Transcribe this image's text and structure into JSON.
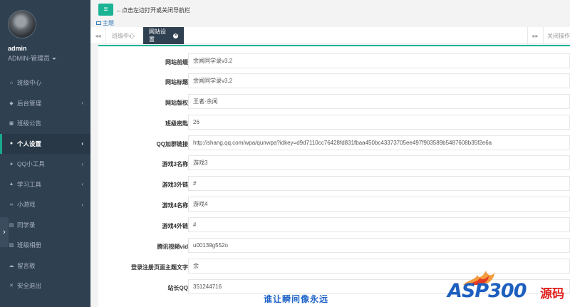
{
  "user": {
    "name": "admin",
    "role": "ADMIN-管理员"
  },
  "topbar": {
    "hint": "←点击左边打开或关闭导航栏",
    "theme": "主题"
  },
  "nav": [
    {
      "label": "班级中心",
      "icon": "home-icon",
      "glyph": "⌂",
      "chevron": false,
      "active": false
    },
    {
      "label": "后台管理",
      "icon": "dashboard-icon",
      "glyph": "◆",
      "chevron": true,
      "active": false
    },
    {
      "label": "班级公告",
      "icon": "bullhorn-icon",
      "glyph": "▣",
      "chevron": false,
      "active": false
    },
    {
      "label": "个人设置",
      "icon": "user-icon",
      "glyph": "●",
      "chevron": true,
      "active": true
    },
    {
      "label": "QQ小工具",
      "icon": "bell-icon",
      "glyph": "♠",
      "chevron": true,
      "active": false
    },
    {
      "label": "学习工具",
      "icon": "graduation-cap-icon",
      "glyph": "▲",
      "chevron": true,
      "active": false
    },
    {
      "label": "小游戏",
      "icon": "gamepad-icon",
      "glyph": "∞",
      "chevron": true,
      "active": false
    },
    {
      "label": "同学录",
      "icon": "address-book-icon",
      "glyph": "▤",
      "chevron": false,
      "active": false
    },
    {
      "label": "班级相册",
      "icon": "image-icon",
      "glyph": "▧",
      "chevron": false,
      "active": false
    },
    {
      "label": "留言板",
      "icon": "cloud-icon",
      "glyph": "☁",
      "chevron": false,
      "active": false
    },
    {
      "label": "安全退出",
      "icon": "close-icon",
      "glyph": "✕",
      "chevron": false,
      "active": false
    }
  ],
  "tabs": {
    "items": [
      "班级中心",
      "网站设置"
    ],
    "close_ops": "关闭操作"
  },
  "form": [
    {
      "label": "网站前缀",
      "value": "余闻同学录v3.2"
    },
    {
      "label": "网站标题",
      "value": "余闻同学录v3.2"
    },
    {
      "label": "网站版权",
      "value": "王者·余闻"
    },
    {
      "label": "班级密匙",
      "value": "26"
    },
    {
      "label": "QQ加群链接",
      "value": "http://shang.qq.com/wpa/qunwpa?idkey=d9d7110cc76428fd831fbaa450bc43373705ee497f903589b5487608b35f2e6a"
    },
    {
      "label": "游戏3名称",
      "value": "游戏3"
    },
    {
      "label": "游戏3外链",
      "value": "#"
    },
    {
      "label": "游戏4名称",
      "value": "游戏4"
    },
    {
      "label": "游戏4外链",
      "value": "#"
    },
    {
      "label": "腾讯视频vid",
      "value": "u00139g552o"
    },
    {
      "label": "登录注册页面主题文字",
      "value": "余"
    },
    {
      "label": "站长QQ",
      "value": "351244716"
    }
  ],
  "watermark": {
    "slogan": "谁让瞬间像永远",
    "logo_text": "ASP300",
    "logo_cn": "源码"
  },
  "colors": {
    "sidebar": "#2f4050",
    "accent": "#1ab394",
    "active_tab": "#2f4050"
  }
}
